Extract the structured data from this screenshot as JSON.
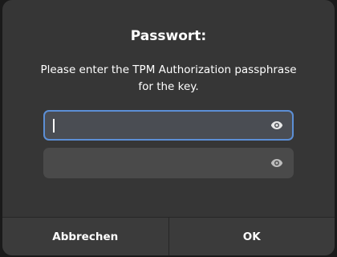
{
  "dialog": {
    "title": "Passwort:",
    "message_line1": "Please enter the TPM Authorization passphrase",
    "message_line2": "for the key."
  },
  "fields": [
    {
      "value": "",
      "reveal_icon": "eye-icon"
    },
    {
      "value": "",
      "reveal_icon": "eye-icon"
    }
  ],
  "buttons": {
    "cancel_label": "Abbrechen",
    "ok_label": "OK"
  },
  "colors": {
    "dialog_bg": "#363636",
    "focus_border": "#5c8fd6",
    "text": "#ffffff"
  }
}
